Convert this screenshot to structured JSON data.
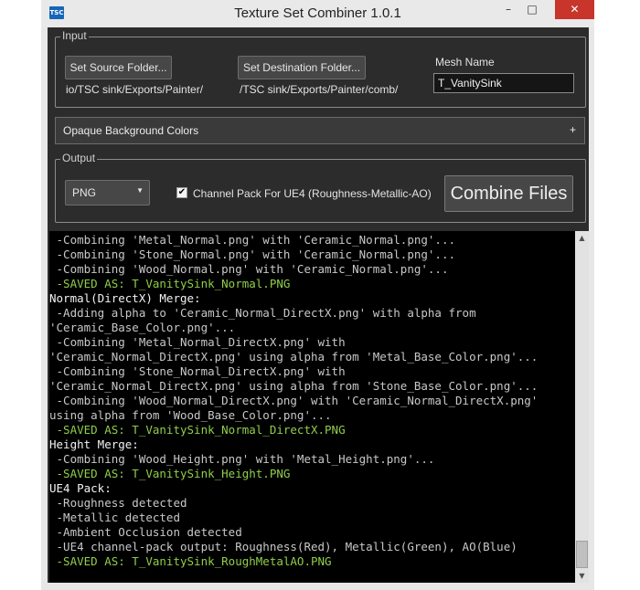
{
  "window": {
    "title": "Texture Set Combiner 1.0.1",
    "icon_text": "TSC",
    "minimize": "–",
    "maximize": "□",
    "close": "✕"
  },
  "input_group": {
    "legend": "Input",
    "source_button": "Set Source Folder...",
    "source_path": "io/TSC sink/Exports/Painter/",
    "dest_button": "Set Destination Folder...",
    "dest_path": "/TSC sink/Exports/Painter/comb/",
    "mesh_label": "Mesh Name",
    "mesh_value": "T_VanitySink"
  },
  "opaque_panel": {
    "title": "Opaque Background Colors",
    "toggle": "+"
  },
  "output_group": {
    "legend": "Output",
    "format_value": "PNG",
    "format_arrow": "▼",
    "channel_pack_checked": "✔",
    "channel_pack_label": "Channel Pack For UE4 (Roughness-Metallic-AO)",
    "combine_button": "Combine Files"
  },
  "scrollbar": {
    "up": "▲",
    "down": "▼"
  },
  "log": [
    {
      "text": " -Combining 'Metal_Normal.png' with 'Ceramic_Normal.png'...",
      "kind": "normal"
    },
    {
      "text": " -Combining 'Stone_Normal.png' with 'Ceramic_Normal.png'...",
      "kind": "normal"
    },
    {
      "text": " -Combining 'Wood_Normal.png' with 'Ceramic_Normal.png'...",
      "kind": "normal"
    },
    {
      "text": " -SAVED AS: T_VanitySink_Normal.PNG",
      "kind": "saved"
    },
    {
      "text": "Normal(DirectX) Merge:",
      "kind": "header"
    },
    {
      "text": " -Adding alpha to 'Ceramic_Normal_DirectX.png' with alpha from",
      "kind": "normal"
    },
    {
      "text": "'Ceramic_Base_Color.png'...",
      "kind": "normal"
    },
    {
      "text": " -Combining 'Metal_Normal_DirectX.png' with",
      "kind": "normal"
    },
    {
      "text": "'Ceramic_Normal_DirectX.png' using alpha from 'Metal_Base_Color.png'...",
      "kind": "normal"
    },
    {
      "text": " -Combining 'Stone_Normal_DirectX.png' with",
      "kind": "normal"
    },
    {
      "text": "'Ceramic_Normal_DirectX.png' using alpha from 'Stone_Base_Color.png'...",
      "kind": "normal"
    },
    {
      "text": " -Combining 'Wood_Normal_DirectX.png' with 'Ceramic_Normal_DirectX.png'",
      "kind": "normal"
    },
    {
      "text": "using alpha from 'Wood_Base_Color.png'...",
      "kind": "normal"
    },
    {
      "text": " -SAVED AS: T_VanitySink_Normal_DirectX.PNG",
      "kind": "saved"
    },
    {
      "text": "Height Merge:",
      "kind": "header"
    },
    {
      "text": " -Combining 'Wood_Height.png' with 'Metal_Height.png'...",
      "kind": "normal"
    },
    {
      "text": " -SAVED AS: T_VanitySink_Height.PNG",
      "kind": "saved"
    },
    {
      "text": "UE4 Pack:",
      "kind": "header"
    },
    {
      "text": " -Roughness detected",
      "kind": "normal"
    },
    {
      "text": " -Metallic detected",
      "kind": "normal"
    },
    {
      "text": " -Ambient Occlusion detected",
      "kind": "normal"
    },
    {
      "text": " -UE4 channel-pack output: Roughness(Red), Metallic(Green), AO(Blue)",
      "kind": "normal"
    },
    {
      "text": " -SAVED AS: T_VanitySink_RoughMetalAO.PNG",
      "kind": "saved"
    }
  ]
}
